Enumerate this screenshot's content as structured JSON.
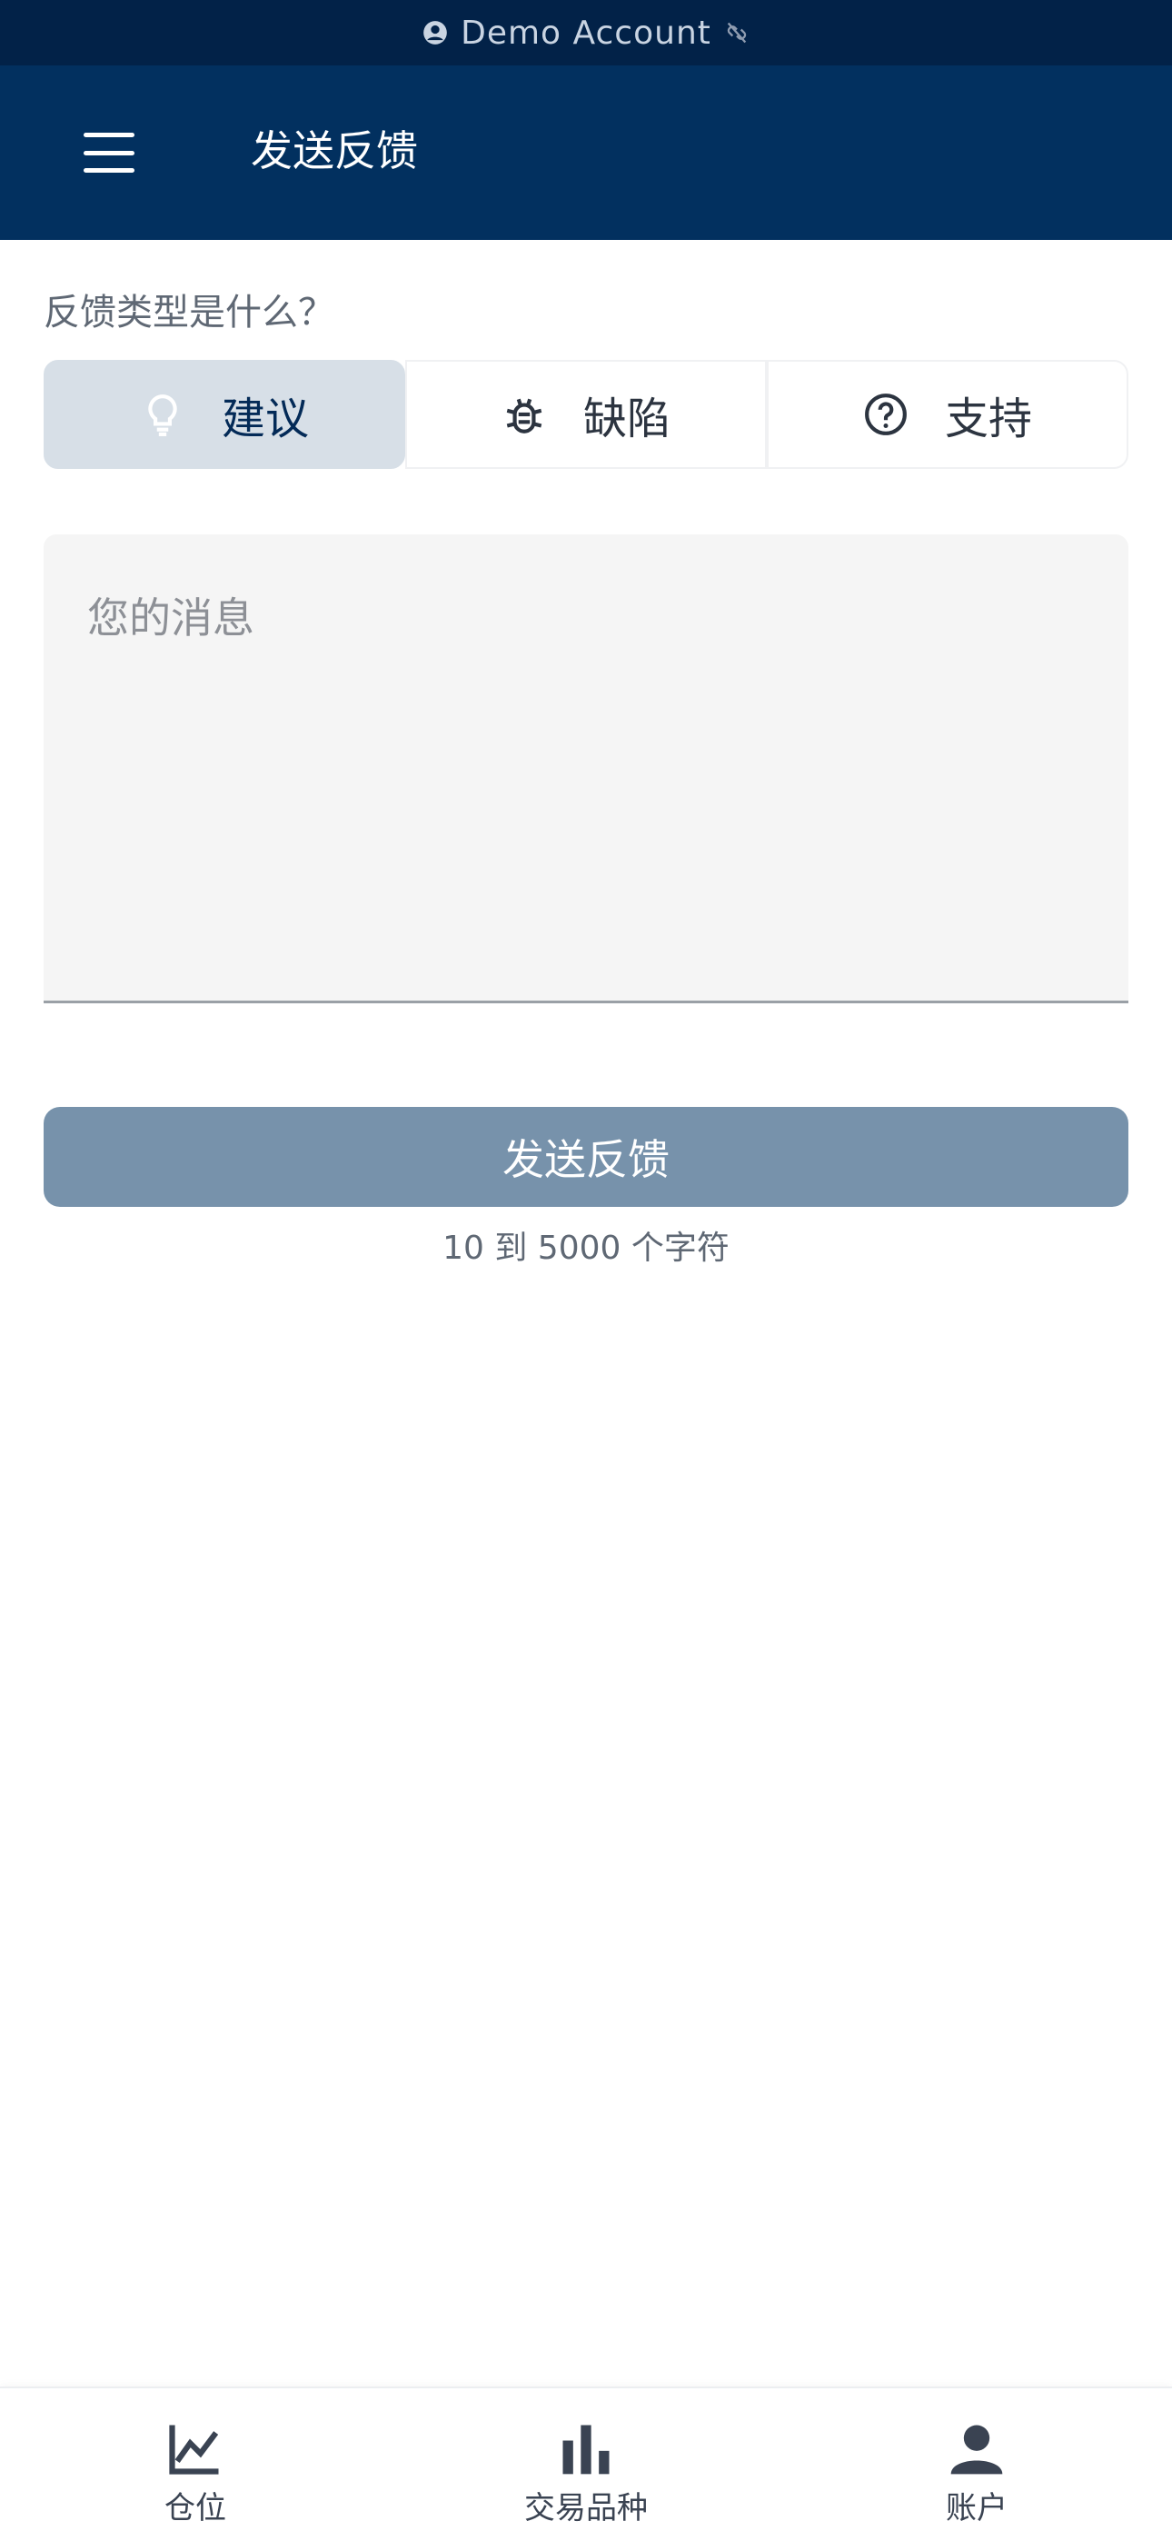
{
  "banner": {
    "text": "Demo Account",
    "account_icon": "account-circle-icon",
    "link_icon": "link-off-icon"
  },
  "header": {
    "title": "发送反馈",
    "menu_icon": "hamburger-menu-icon"
  },
  "form": {
    "question": "反馈类型是什么？",
    "types": [
      {
        "label": "建议",
        "icon": "lightbulb-icon",
        "selected": true
      },
      {
        "label": "缺陷",
        "icon": "bug-icon",
        "selected": false
      },
      {
        "label": "支持",
        "icon": "help-circle-icon",
        "selected": false
      }
    ],
    "message_placeholder": "您的消息",
    "message_value": "",
    "send_label": "发送反馈",
    "char_hint": "10 到 5000 个字符"
  },
  "bottom_nav": [
    {
      "label": "仓位",
      "icon": "line-chart-icon"
    },
    {
      "label": "交易品种",
      "icon": "bar-chart-icon"
    },
    {
      "label": "账户",
      "icon": "person-icon"
    }
  ],
  "colors": {
    "banner_bg": "#022248",
    "header_bg": "#02305f",
    "selected_bg": "#d7dfe7",
    "button_bg": "#7792ab"
  }
}
